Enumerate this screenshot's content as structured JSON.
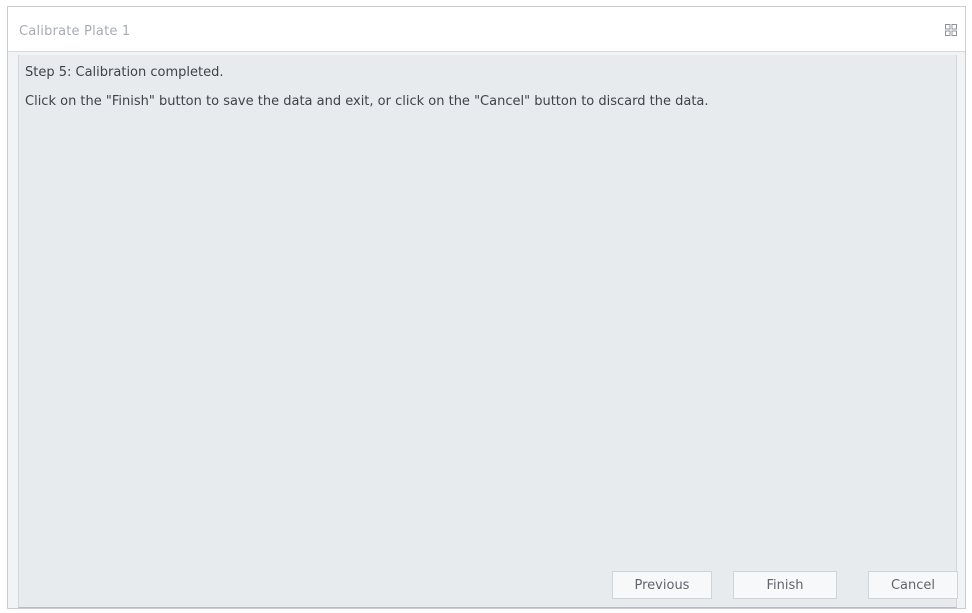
{
  "dialog": {
    "title": "Calibrate Plate 1",
    "maximize_icon": "maximize-icon"
  },
  "content": {
    "step": "Step 5: Calibration completed.",
    "instruction": "Click on the \"Finish\" button to save the data and exit, or click on the \"Cancel\" button to discard the data."
  },
  "buttons": {
    "previous": "Previous",
    "finish": "Finish",
    "cancel": "Cancel"
  },
  "colors": {
    "content_background": "#e8ebee",
    "title_text": "#a7acb3",
    "body_text": "#3f4349"
  }
}
